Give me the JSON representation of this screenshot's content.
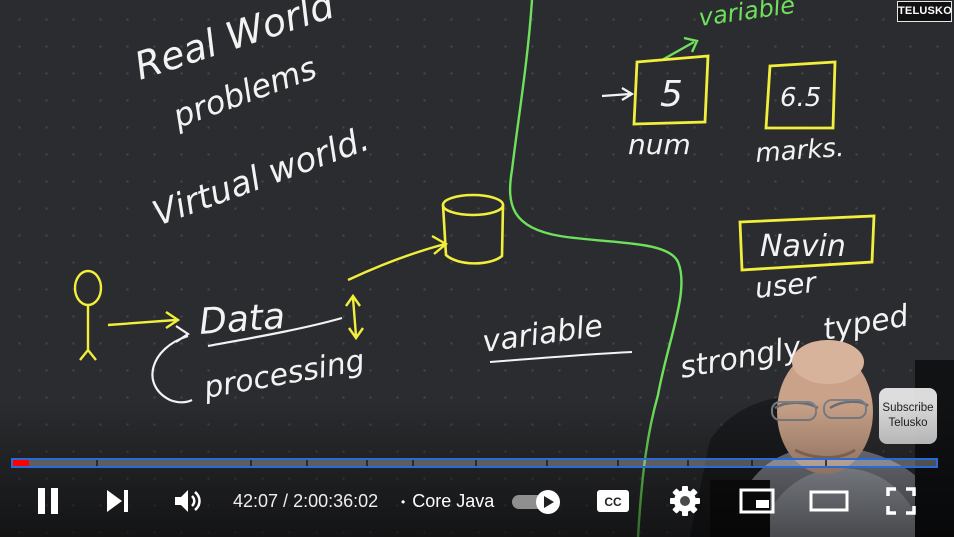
{
  "watermark": {
    "text": "TELUSKO"
  },
  "whiteboard": {
    "notes": {
      "real_world": "Real World",
      "problems": "problems",
      "virtual_world": "Virtual world.",
      "data": "Data",
      "processing": "processing",
      "variable_center": "variable",
      "variable_top": "variable",
      "num_value": "5",
      "num_label": "num",
      "marks_value": "6.5",
      "marks_label": "marks.",
      "navin_value": "Navin",
      "user_label": "user",
      "strongly_typed_a": "strongly",
      "strongly_typed_b": "typed"
    }
  },
  "presenter": {
    "subscribe_line1": "Subscribe",
    "subscribe_line2": "Telusko"
  },
  "player": {
    "progress_fraction": 0.0175,
    "current_time": "42:07",
    "separator": " / ",
    "duration": "2:00:36:02",
    "chapter_bullet": "•",
    "chapter_title": "Core Java",
    "autoplay_on": true,
    "captions_label": "CC",
    "accent_color": "#ff0000",
    "focus_ring_color": "#2a6ad8"
  },
  "colors": {
    "ink_yellow": "#f2ee3c",
    "ink_green": "#6fe05c",
    "ink_white": "#f3f3f3"
  }
}
